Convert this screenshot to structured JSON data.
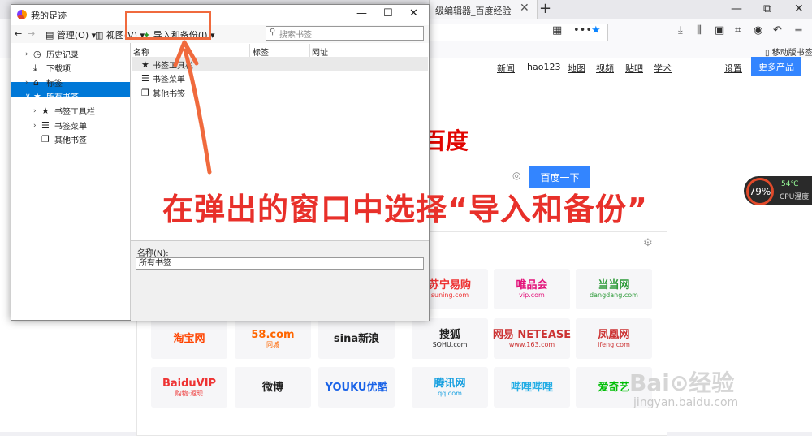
{
  "browser": {
    "tab_title": "级编辑器_百度经验",
    "tab_close": "✕",
    "new_tab": "+",
    "win_min": "—",
    "win_restore": "⧉",
    "win_close": "✕",
    "mobile_bookmarks": "移动版书签"
  },
  "baidu": {
    "nav": [
      "新闻",
      "hao123",
      "地图",
      "视频",
      "贴吧",
      "学术"
    ],
    "settings": "设置",
    "more_products": "更多产品",
    "logo_text": "百度",
    "search_button": "百度一下",
    "tiles": [
      {
        "t": "苏宁易购",
        "s": "suning.com",
        "color": "#e33"
      },
      {
        "t": "唯品会",
        "s": "vip.com",
        "color": "#e3127a"
      },
      {
        "t": "当当网",
        "s": "dangdang.com",
        "color": "#2e9b3a"
      },
      {
        "t": "淘宝网",
        "s": "",
        "color": "#f40"
      },
      {
        "t": "58.com",
        "s": "同城",
        "color": "#f60"
      },
      {
        "t": "sina新浪",
        "s": "",
        "color": "#222"
      },
      {
        "t": "搜狐",
        "s": "SOHU.com",
        "color": "#222"
      },
      {
        "t": "网易 NETEASE",
        "s": "www.163.com",
        "color": "#c33"
      },
      {
        "t": "凤凰网",
        "s": "ifeng.com",
        "color": "#c33"
      },
      {
        "t": "BaiduVIP",
        "s": "购物·返现",
        "color": "#e33"
      },
      {
        "t": "微博",
        "s": "",
        "color": "#222"
      },
      {
        "t": "YOUKU优酷",
        "s": "",
        "color": "#1a63e8"
      },
      {
        "t": "腾讯网",
        "s": "qq.com",
        "color": "#18a0e0"
      },
      {
        "t": "哔哩哔哩",
        "s": "",
        "color": "#23ade5"
      },
      {
        "t": "爱奇艺",
        "s": "",
        "color": "#00be06"
      }
    ]
  },
  "cpu_widget": {
    "usage": "79%",
    "temp": "54℃",
    "label": "CPU温度"
  },
  "library": {
    "title": "我的足迹",
    "toolbar": {
      "manage": "管理(O)",
      "views": "视图(V)",
      "import_backup": "导入和备份(I)",
      "search_placeholder": "搜索书签"
    },
    "tree": [
      {
        "label": "历史记录",
        "icon": "◷",
        "chev": "›"
      },
      {
        "label": "下载项",
        "icon": "⤓",
        "chev": ""
      },
      {
        "label": "标签",
        "icon": "⌂",
        "chev": "›"
      },
      {
        "label": "所有书签",
        "icon": "★",
        "chev": "∨"
      },
      {
        "label": "书签工具栏",
        "icon": "★",
        "chev": "›"
      },
      {
        "label": "书签菜单",
        "icon": "☰",
        "chev": "›"
      },
      {
        "label": "其他书签",
        "icon": "❐",
        "chev": ""
      }
    ],
    "columns": [
      "名称",
      "标签",
      "网址"
    ],
    "list": [
      {
        "label": "书签工具栏",
        "icon": "★"
      },
      {
        "label": "书签菜单",
        "icon": "☰"
      },
      {
        "label": "其他书签",
        "icon": "❐"
      }
    ],
    "details": {
      "name_label": "名称(N):",
      "name_value": "所有书签"
    }
  },
  "annotation": {
    "text": "在弹出的窗口中选择“导入和备份”",
    "color": "#e8302a",
    "arrow_color": "#f06a3d"
  },
  "watermark": {
    "text": "Bai⊙经验",
    "sub": "jingyan.baidu.com"
  }
}
